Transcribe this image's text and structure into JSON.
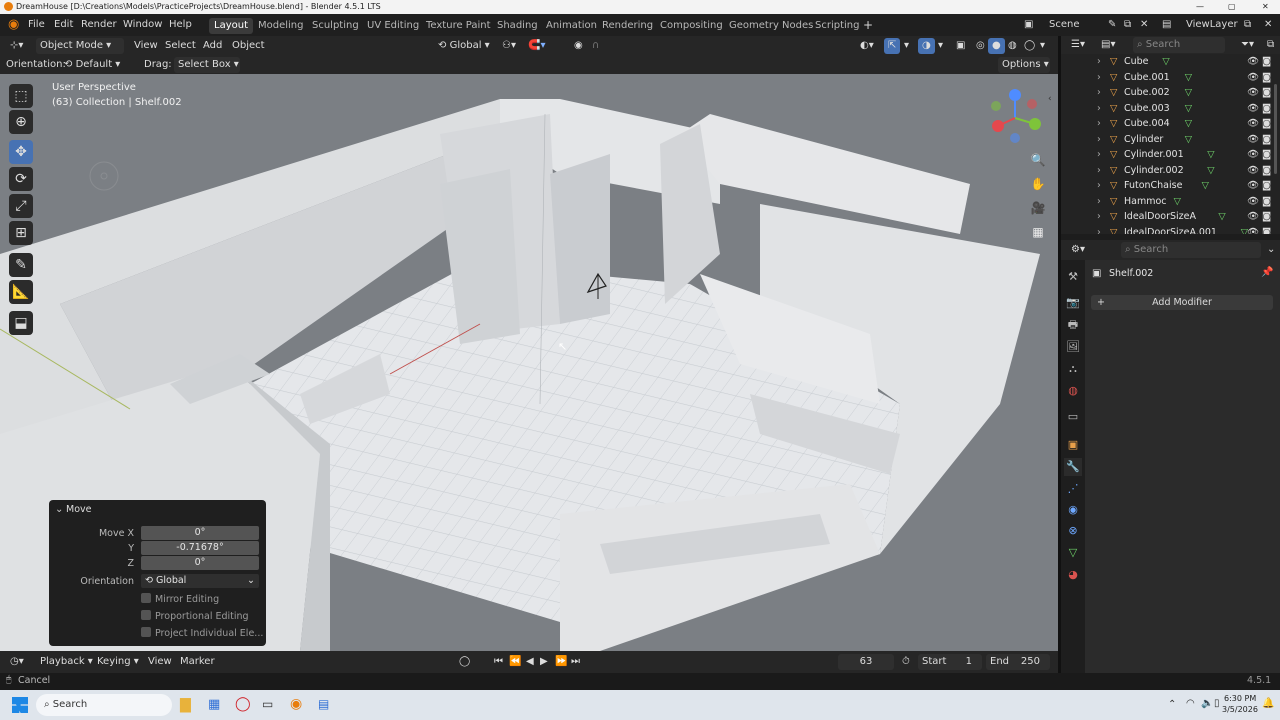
{
  "window": {
    "title": "DreamHouse [D:\\Creations\\Models\\PracticeProjects\\DreamHouse.blend] - Blender 4.5.1 LTS"
  },
  "menu": [
    "File",
    "Edit",
    "Render",
    "Window",
    "Help"
  ],
  "workspaces": [
    "Layout",
    "Modeling",
    "Sculpting",
    "UV Editing",
    "Texture Paint",
    "Shading",
    "Animation",
    "Rendering",
    "Compositing",
    "Geometry Nodes",
    "Scripting"
  ],
  "active_workspace": "Layout",
  "scene": {
    "name": "Scene",
    "view_layer": "ViewLayer"
  },
  "viewport_header": {
    "mode": "Object Mode",
    "menus": [
      "View",
      "Select",
      "Add",
      "Object"
    ],
    "transform": "Global"
  },
  "toolsettings": {
    "orientation_label": "Orientation:",
    "orientation_value": "Default",
    "drag_label": "Drag:",
    "drag_value": "Select Box",
    "options": "Options"
  },
  "viewport": {
    "perspective": "User Perspective",
    "collection_info": "(63) Collection | Shelf.002"
  },
  "move_panel": {
    "title": "Move",
    "move_x_label": "Move X",
    "move_x": "0°",
    "y_label": "Y",
    "y": "-0.71678°",
    "z_label": "Z",
    "z": "0°",
    "orientation_label": "Orientation",
    "orientation_value": "Global",
    "mirror": "Mirror Editing",
    "proportional": "Proportional Editing",
    "project": "Project Individual Ele..."
  },
  "timeline": {
    "menus": [
      "Playback",
      "Keying",
      "View",
      "Marker"
    ],
    "current_frame": "63",
    "start_label": "Start",
    "start": "1",
    "end_label": "End",
    "end": "250"
  },
  "status": {
    "left": "Cancel",
    "version": "4.5.1"
  },
  "outliner": {
    "search_placeholder": "Search",
    "items": [
      "Cube",
      "Cube.001",
      "Cube.002",
      "Cube.003",
      "Cube.004",
      "Cylinder",
      "Cylinder.001",
      "Cylinder.002",
      "FutonChaise",
      "Hammoc",
      "IdealDoorSizeA",
      "IdealDoorSizeA.001"
    ]
  },
  "properties": {
    "search_placeholder": "Search",
    "object": "Shelf.002",
    "add_modifier": "Add Modifier"
  },
  "taskbar": {
    "search": "Search",
    "time": "6:30 PM",
    "date": "3/5/2026"
  },
  "colors": {
    "accent": "#4772b3",
    "object_orange": "#e8a04a",
    "mesh_green": "#6fd36a"
  }
}
